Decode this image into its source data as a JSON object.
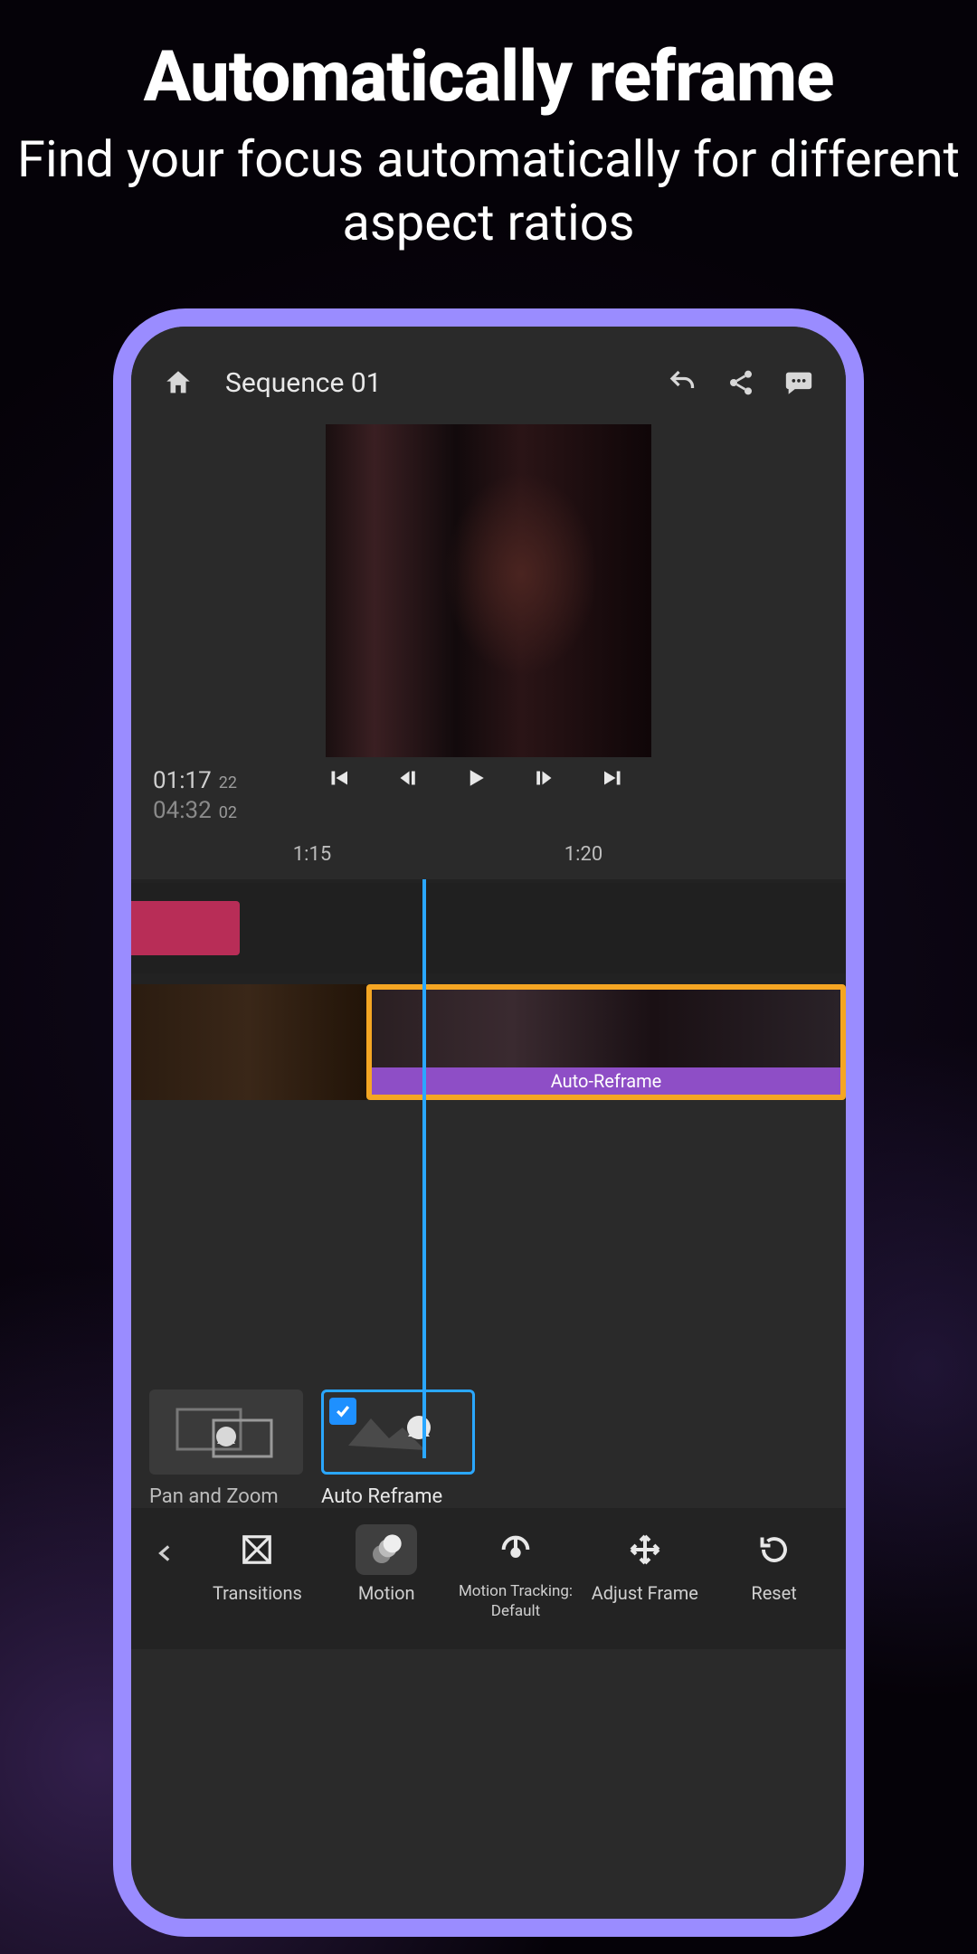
{
  "promo": {
    "headline": "Automatically reframe",
    "subline": "Find your focus automatically for different aspect ratios"
  },
  "header": {
    "title": "Sequence 01"
  },
  "playback": {
    "current_time": "01:17",
    "current_frames": "22",
    "duration": "04:32",
    "duration_frames": "02"
  },
  "ruler": {
    "marks": [
      "1:15",
      "1:20"
    ]
  },
  "timeline": {
    "selected_clip_effect": "Auto-Reframe"
  },
  "motion_options": {
    "pan_zoom": "Pan and Zoom",
    "auto_reframe": "Auto Reframe"
  },
  "bottom_nav": {
    "transitions": "Transitions",
    "motion": "Motion",
    "motion_tracking_line1": "Motion Tracking:",
    "motion_tracking_line2": "Default",
    "adjust_frame": "Adjust Frame",
    "reset": "Reset"
  }
}
